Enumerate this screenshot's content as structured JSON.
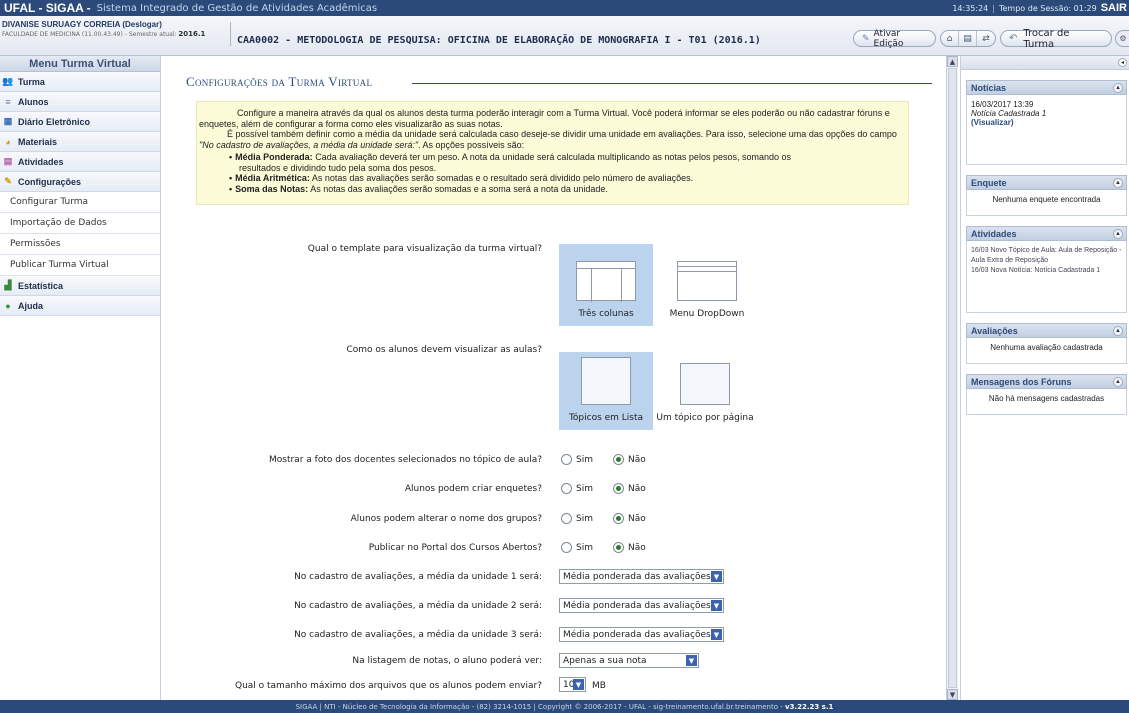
{
  "topbar": {
    "app_name": "UFAL - SIGAA -",
    "app_desc": "Sistema Integrado de Gestão de Atividades Acadêmicas",
    "time": "14:35:24",
    "session": "Tempo de Sessão: 01:29",
    "exit": "SAIR"
  },
  "user": {
    "name": "DIVANISE SURUAGY CORREIA",
    "logout": "(Deslogar)",
    "faculty": "FACULDADE DE MEDICINA (11.00.43.49) - Semestre atual:",
    "semester": "2016.1"
  },
  "course": {
    "title": "CAA0002 - METODOLOGIA DE PESQUISA: OFICINA DE ELABORAÇÃO DE MONOGRAFIA I - T01 (2016.1)"
  },
  "toolbar": {
    "edit_label": "Ativar Edição",
    "switch_label": "Trocar de Turma"
  },
  "menu": {
    "title": "Menu Turma Virtual",
    "items": [
      {
        "label": "Turma",
        "icon": "group-icon"
      },
      {
        "label": "Alunos",
        "icon": "students-icon"
      },
      {
        "label": "Diário Eletrônico",
        "icon": "book-icon"
      },
      {
        "label": "Materiais",
        "icon": "materials-icon"
      },
      {
        "label": "Atividades",
        "icon": "activities-icon"
      },
      {
        "label": "Configurações",
        "icon": "settings-icon"
      }
    ],
    "sub_items": [
      {
        "label": "Configurar Turma"
      },
      {
        "label": "Importação de Dados"
      },
      {
        "label": "Permissões"
      },
      {
        "label": "Publicar Turma Virtual"
      }
    ],
    "bottom_items": [
      {
        "label": "Estatística",
        "icon": "chart-icon"
      },
      {
        "label": "Ajuda",
        "icon": "help-icon"
      }
    ]
  },
  "page": {
    "title": "Configurações da Turma Virtual",
    "info_p1": "Configure a maneira através da qual os alunos desta turma poderão interagir com a Turma Virtual. Você poderá informar se eles poderão ou não cadastrar fóruns e enquetes, além de configurar a forma como eles visualizarão as suas notas.",
    "info_p2": "É possível também definir como a média da unidade será calculada caso deseje-se dividir uma unidade em avaliações. Para isso, selecione uma das opções do campo",
    "info_p2_italic": "\"No cadastro de avaliações, a média da unidade será:\"",
    "info_p2_end": ". As opções possíveis são:",
    "bullets": [
      {
        "term": "Média Ponderada:",
        "text": "Cada avaliação deverá ter um peso. A nota da unidade será calculada multiplicando as notas pelos pesos, somando os",
        "text2": "resultados e dividindo tudo pela soma dos pesos."
      },
      {
        "term": "Média Aritmética:",
        "text": "As notas das avaliações serão somadas e o resultado será dividido pelo número de avaliações.",
        "text2": ""
      },
      {
        "term": "Soma das Notas:",
        "text": "As notas das avaliações serão somadas e a soma será a nota da unidade.",
        "text2": ""
      }
    ]
  },
  "form": {
    "q_template": "Qual o template para visualização da turma virtual?",
    "tpl_options": [
      "Três colunas",
      "Menu DropDown"
    ],
    "q_aulas": "Como os alunos devem visualizar as aulas?",
    "aula_options": [
      "Tópicos em Lista",
      "Um tópico por página"
    ],
    "q_foto": "Mostrar a foto dos docentes selecionados no tópico de aula?",
    "q_enquetes": "Alunos podem criar enquetes?",
    "q_grupos": "Alunos podem alterar o nome dos grupos?",
    "q_portal": "Publicar no Portal dos Cursos Abertos?",
    "sim": "Sim",
    "nao": "Não",
    "q_media1": "No cadastro de avaliações, a média da unidade 1 será:",
    "q_media2": "No cadastro de avaliações, a média da unidade 2 será:",
    "q_media3": "No cadastro de avaliações, a média da unidade 3 será:",
    "media_value": "Média ponderada das avaliações",
    "q_notas": "Na listagem de notas, o aluno poderá ver:",
    "notas_value": "Apenas a sua nota",
    "q_tamanho": "Qual o tamanho máximo dos arquivos que os alunos podem enviar?",
    "tamanho_value": "10",
    "tamanho_unit": "MB"
  },
  "right": {
    "noticias": {
      "title": "Notícias",
      "date": "16/03/2017 13:39",
      "item": "Notícia Cadastrada 1",
      "link": "(Visualizar)"
    },
    "enquete": {
      "title": "Enquete",
      "empty": "Nenhuma enquete encontrada"
    },
    "atividades": {
      "title": "Atividades",
      "line1": "16/03 Novo Tópico de Aula: Aula de Reposição - Aula Extra de Reposição",
      "line2": "16/03 Nova Notícia: Notícia Cadastrada 1"
    },
    "avaliacoes": {
      "title": "Avaliações",
      "empty": "Nenhuma avaliação cadastrada"
    },
    "foruns": {
      "title": "Mensagens dos Fóruns",
      "empty": "Não há mensagens cadastradas"
    }
  },
  "footer": {
    "text": "SIGAA | NTI - Núcleo de Tecnologia da Informação - (82) 3214-1015 | Copyright © 2006-2017 - UFAL - sig-treinamento.ufal.br.treinamento -",
    "version": "v3.22.23 s.1"
  }
}
